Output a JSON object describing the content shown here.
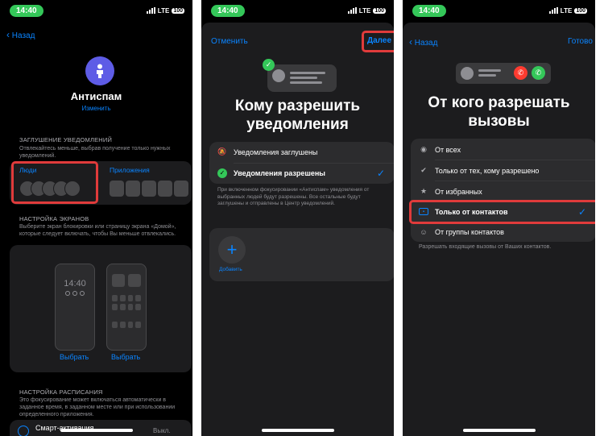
{
  "status": {
    "time": "14:40",
    "network": "LTE",
    "battery": "100"
  },
  "screen1": {
    "back_label": "Назад",
    "title": "Антиспам",
    "edit_label": "Изменить",
    "silence_header": "ЗАГЛУШЕНИЕ УВЕДОМЛЕНИЙ",
    "silence_desc": "Отвлекайтесь меньше, выбрав получение только нужных уведомлений.",
    "people_label": "Люди",
    "apps_label": "Приложения",
    "screens_header": "НАСТРОЙКА ЭКРАНОВ",
    "screens_desc": "Выберите экран блокировки или страницу экрана «Домой», которые следует включать, чтобы Вы меньше отвлекались.",
    "lock_time": "14:40",
    "choose_lock": "Выбрать",
    "choose_home": "Выбрать",
    "schedule_header": "НАСТРОЙКА РАСПИСАНИЯ",
    "schedule_desc": "Это фокусирование может включаться автоматически в заданное время, в заданном месте или при использовании определенного приложения.",
    "smart_label": "Смарт-активация",
    "smart_value": "Выкл."
  },
  "screen2": {
    "cancel_label": "Отменить",
    "next_label": "Далее",
    "title": "Кому разрешить уведомления",
    "option_silenced": "Уведомления заглушены",
    "option_allowed": "Уведомления разрешены",
    "description": "При включенном фокусировании «Антиспам» уведомления от выбранных людей будут разрешены. Все остальные будут заглушены и отправлены в Центр уведомлений.",
    "add_label": "Добавить"
  },
  "screen3": {
    "back_label": "Назад",
    "done_label": "Готово",
    "title": "От кого разрешать вызовы",
    "options": [
      {
        "label": "От всех",
        "icon": "person-circle-icon"
      },
      {
        "label": "Только от тех, кому разрешено",
        "icon": "checkmark-seal-icon"
      },
      {
        "label": "От избранных",
        "icon": "star-icon"
      },
      {
        "label": "Только от контактов",
        "icon": "contact-card-icon"
      },
      {
        "label": "От группы контактов",
        "icon": "group-icon"
      }
    ],
    "description": "Разрешать входящие вызовы от Ваших контактов."
  },
  "colors": {
    "accent": "#0a84ff",
    "highlight": "#e03b3b",
    "focus": "#5e5ce6",
    "green": "#34c759",
    "red": "#ff3b30"
  }
}
